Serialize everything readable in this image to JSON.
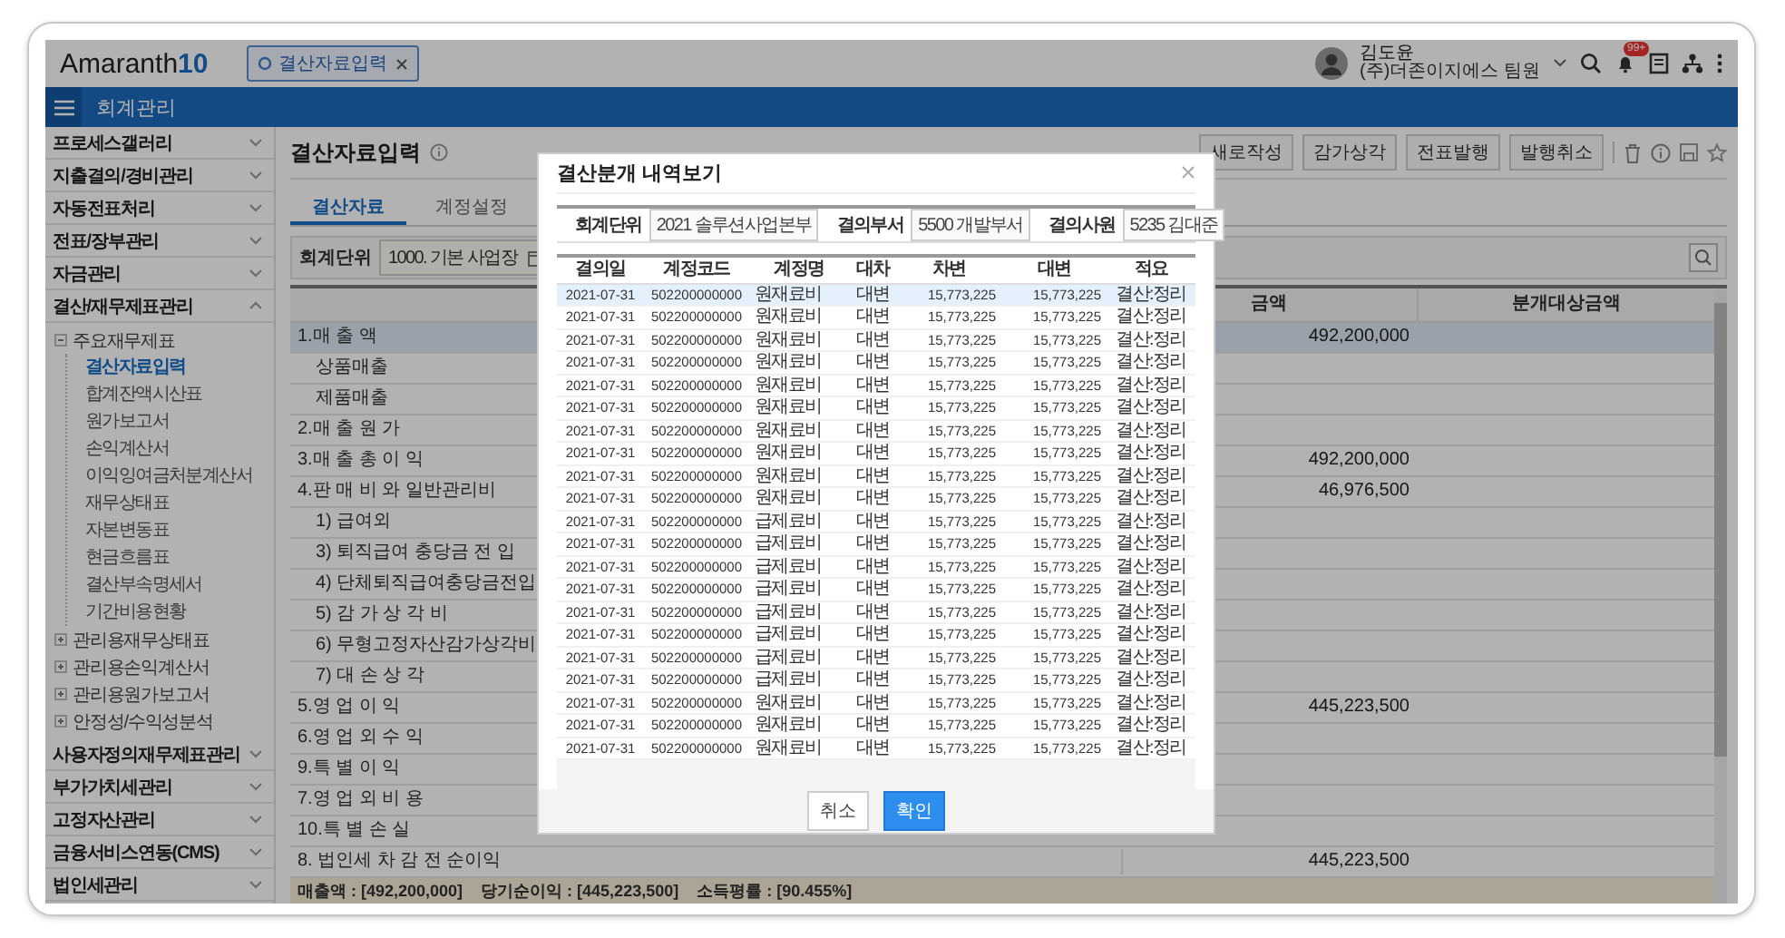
{
  "header": {
    "logo": {
      "name": "Amaranth",
      "version": "10"
    },
    "open_tabs": [
      {
        "label": "결산자료입력",
        "selected": true
      }
    ],
    "user": {
      "name": "김도윤",
      "org": "(주)더존이지에스 팀원"
    },
    "notification_count": "99+"
  },
  "module_bar": {
    "title": "회계관리"
  },
  "sidebar": {
    "items": [
      {
        "label": "프로세스갤러리",
        "expanded": false
      },
      {
        "label": "지출결의/경비관리",
        "expanded": false
      },
      {
        "label": "자동전표처리",
        "expanded": false
      },
      {
        "label": "전표/장부관리",
        "expanded": false
      },
      {
        "label": "자금관리",
        "expanded": false
      },
      {
        "label": "결산/재무제표관리",
        "expanded": true,
        "children": [
          {
            "label": "주요재무제표",
            "expanded": true,
            "children": [
              {
                "label": "결산자료입력",
                "selected": true
              },
              {
                "label": "합계잔액시산표",
                "selected": false
              },
              {
                "label": "원가보고서",
                "selected": false
              },
              {
                "label": "손익계산서",
                "selected": false
              },
              {
                "label": "이익잉여금처분계산서",
                "selected": false
              },
              {
                "label": "재무상태표",
                "selected": false
              },
              {
                "label": "자본변동표",
                "selected": false
              },
              {
                "label": "현금흐름표",
                "selected": false
              },
              {
                "label": "결산부속명세서",
                "selected": false
              },
              {
                "label": "기간비용현황",
                "selected": false
              }
            ]
          },
          {
            "label": "관리용재무상태표",
            "expanded": false
          },
          {
            "label": "관리용손익계산서",
            "expanded": false
          },
          {
            "label": "관리용원가보고서",
            "expanded": false
          },
          {
            "label": "안정성/수익성분석",
            "expanded": false
          }
        ]
      },
      {
        "label": "사용자정의재무제표관리",
        "expanded": false
      },
      {
        "label": "부가가치세관리",
        "expanded": false
      },
      {
        "label": "고정자산관리",
        "expanded": false
      },
      {
        "label": "금융서비스연동(CMS)",
        "expanded": false
      },
      {
        "label": "법인세관리",
        "expanded": false
      }
    ]
  },
  "page": {
    "title": "결산자료입력",
    "toolbar_buttons": [
      "새로작성",
      "감가상각",
      "전표발행",
      "발행취소"
    ],
    "tabs": [
      {
        "label": "결산자료",
        "selected": true
      },
      {
        "label": "계정설정",
        "selected": false
      }
    ],
    "filter": {
      "label": "회계단위",
      "value": "1000. 기본 사업장"
    }
  },
  "table": {
    "columns": [
      "금액",
      "분개대상금액"
    ],
    "rows": [
      {
        "label": "1.매 출 액",
        "amount": "492,200,000",
        "selected": true,
        "children": [
          {
            "label": "상품매출",
            "selected": false
          },
          {
            "label": "제품매출",
            "selected": false
          }
        ]
      },
      {
        "label": "2.매 출 원 가",
        "selected": false
      },
      {
        "label": "3.매 출 총 이 익",
        "amount": "492,200,000",
        "selected": false
      },
      {
        "label": "4.판 매 비 와 일반관리비",
        "amount": "46,976,500",
        "selected": false,
        "children": [
          {
            "label": "1) 급여외",
            "selected": false
          },
          {
            "label": "3) 퇴직급여 충당금 전 입",
            "selected": false
          },
          {
            "label": "4) 단체퇴직급여충당금전입",
            "selected": false
          },
          {
            "label": "5) 감 가 상 각 비",
            "selected": false
          },
          {
            "label": "6) 무형고정자산감가상각비",
            "selected": false
          },
          {
            "label": "7) 대 손 상 각",
            "selected": false
          }
        ]
      },
      {
        "label": "5.영 업 이 익",
        "amount": "445,223,500",
        "selected": false
      },
      {
        "label": "6.영 업 외 수 익",
        "selected": false
      },
      {
        "label": "9.특 별 이 익",
        "selected": false
      },
      {
        "label": "7.영 업 외 비 용",
        "selected": false
      },
      {
        "label": "10.특 별 손 실",
        "selected": false
      },
      {
        "label": "8. 법인세 차 감 전 순이익",
        "amount": "445,223,500",
        "selected": false
      }
    ],
    "footer": [
      "매출액 : [492,200,000]",
      "당기순이익 : [445,223,500]",
      "소득평률 : [90.455%]"
    ]
  },
  "dialog": {
    "title": "결산분개 내역보기",
    "fields": [
      {
        "label": "회계단위",
        "value": "2021 솔루션사업본부"
      },
      {
        "label": "결의부서",
        "value": "5500 개발부서"
      },
      {
        "label": "결의사원",
        "value": "5235 김대준"
      }
    ],
    "columns": [
      "결의일",
      "계정코드",
      "계정명",
      "대차",
      "차변",
      "대변",
      "적요"
    ],
    "rows": [
      {
        "date": "2021-07-31",
        "code": "502200000000",
        "account": "원재료비",
        "side": "대변",
        "debit": "15,773,225",
        "credit": "15,773,225",
        "memo": "결산:정리",
        "selected": true
      },
      {
        "date": "2021-07-31",
        "code": "502200000000",
        "account": "원재료비",
        "side": "대변",
        "debit": "15,773,225",
        "credit": "15,773,225",
        "memo": "결산:정리",
        "selected": false
      },
      {
        "date": "2021-07-31",
        "code": "502200000000",
        "account": "원재료비",
        "side": "대변",
        "debit": "15,773,225",
        "credit": "15,773,225",
        "memo": "결산:정리",
        "selected": false
      },
      {
        "date": "2021-07-31",
        "code": "502200000000",
        "account": "원재료비",
        "side": "대변",
        "debit": "15,773,225",
        "credit": "15,773,225",
        "memo": "결산:정리",
        "selected": false
      },
      {
        "date": "2021-07-31",
        "code": "502200000000",
        "account": "원재료비",
        "side": "대변",
        "debit": "15,773,225",
        "credit": "15,773,225",
        "memo": "결산:정리",
        "selected": false
      },
      {
        "date": "2021-07-31",
        "code": "502200000000",
        "account": "원재료비",
        "side": "대변",
        "debit": "15,773,225",
        "credit": "15,773,225",
        "memo": "결산:정리",
        "selected": false
      },
      {
        "date": "2021-07-31",
        "code": "502200000000",
        "account": "원재료비",
        "side": "대변",
        "debit": "15,773,225",
        "credit": "15,773,225",
        "memo": "결산:정리",
        "selected": false
      },
      {
        "date": "2021-07-31",
        "code": "502200000000",
        "account": "원재료비",
        "side": "대변",
        "debit": "15,773,225",
        "credit": "15,773,225",
        "memo": "결산:정리",
        "selected": false
      },
      {
        "date": "2021-07-31",
        "code": "502200000000",
        "account": "원재료비",
        "side": "대변",
        "debit": "15,773,225",
        "credit": "15,773,225",
        "memo": "결산:정리",
        "selected": false
      },
      {
        "date": "2021-07-31",
        "code": "502200000000",
        "account": "원재료비",
        "side": "대변",
        "debit": "15,773,225",
        "credit": "15,773,225",
        "memo": "결산:정리",
        "selected": false
      },
      {
        "date": "2021-07-31",
        "code": "502200000000",
        "account": "급제료비",
        "side": "대변",
        "debit": "15,773,225",
        "credit": "15,773,225",
        "memo": "결산:정리",
        "selected": false
      },
      {
        "date": "2021-07-31",
        "code": "502200000000",
        "account": "급제료비",
        "side": "대변",
        "debit": "15,773,225",
        "credit": "15,773,225",
        "memo": "결산:정리",
        "selected": false
      },
      {
        "date": "2021-07-31",
        "code": "502200000000",
        "account": "급제료비",
        "side": "대변",
        "debit": "15,773,225",
        "credit": "15,773,225",
        "memo": "결산:정리",
        "selected": false
      },
      {
        "date": "2021-07-31",
        "code": "502200000000",
        "account": "급제료비",
        "side": "대변",
        "debit": "15,773,225",
        "credit": "15,773,225",
        "memo": "결산:정리",
        "selected": false
      },
      {
        "date": "2021-07-31",
        "code": "502200000000",
        "account": "급제료비",
        "side": "대변",
        "debit": "15,773,225",
        "credit": "15,773,225",
        "memo": "결산:정리",
        "selected": false
      },
      {
        "date": "2021-07-31",
        "code": "502200000000",
        "account": "급제료비",
        "side": "대변",
        "debit": "15,773,225",
        "credit": "15,773,225",
        "memo": "결산:정리",
        "selected": false
      },
      {
        "date": "2021-07-31",
        "code": "502200000000",
        "account": "급제료비",
        "side": "대변",
        "debit": "15,773,225",
        "credit": "15,773,225",
        "memo": "결산:정리",
        "selected": false
      },
      {
        "date": "2021-07-31",
        "code": "502200000000",
        "account": "급제료비",
        "side": "대변",
        "debit": "15,773,225",
        "credit": "15,773,225",
        "memo": "결산:정리",
        "selected": false
      },
      {
        "date": "2021-07-31",
        "code": "502200000000",
        "account": "원재료비",
        "side": "대변",
        "debit": "15,773,225",
        "credit": "15,773,225",
        "memo": "결산:정리",
        "selected": false
      },
      {
        "date": "2021-07-31",
        "code": "502200000000",
        "account": "원재료비",
        "side": "대변",
        "debit": "15,773,225",
        "credit": "15,773,225",
        "memo": "결산:정리",
        "selected": false
      },
      {
        "date": "2021-07-31",
        "code": "502200000000",
        "account": "원재료비",
        "side": "대변",
        "debit": "15,773,225",
        "credit": "15,773,225",
        "memo": "결산:정리",
        "selected": false
      }
    ],
    "buttons": [
      {
        "label": "취소",
        "kind": "secondary"
      },
      {
        "label": "확인",
        "kind": "primary"
      }
    ]
  }
}
